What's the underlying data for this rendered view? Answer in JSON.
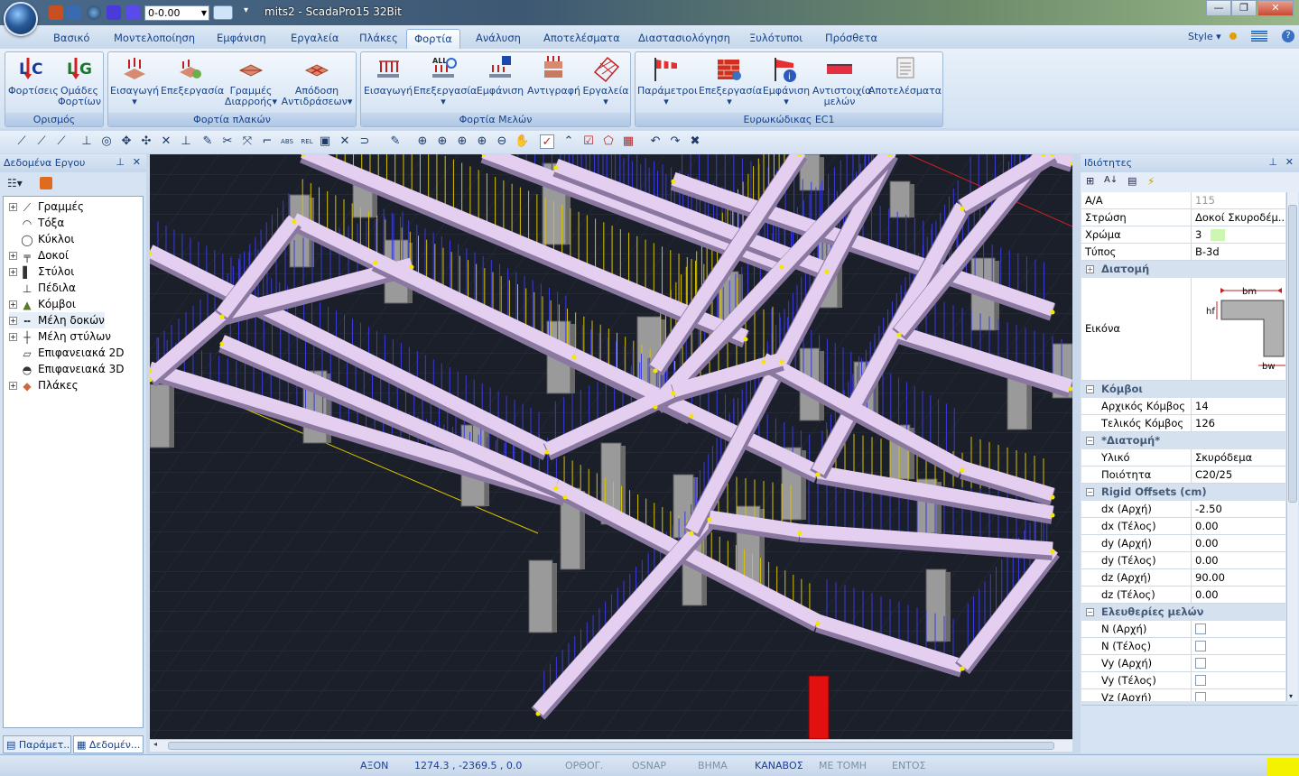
{
  "titlebar": {
    "title": "mits2 - ScadaPro15 32Bit",
    "level_value": "0-0.00",
    "buttons": {
      "minimize": "—",
      "restore": "❐",
      "close": "✕"
    }
  },
  "menu": {
    "tabs": [
      "Βασικό",
      "Μοντελοποίηση",
      "Εμφάνιση",
      "Εργαλεία",
      "Πλάκες",
      "Φορτία",
      "Ανάλυση",
      "Αποτελέσματα",
      "Διαστασιολόγηση",
      "Ξυλότυποι",
      "Πρόσθετα"
    ],
    "active_tab": "Φορτία",
    "style_label": "Style"
  },
  "ribbon": {
    "groups": [
      {
        "title": "Ορισμός",
        "buttons": [
          {
            "label": "Φορτίσεις",
            "icon": "lc-icon"
          },
          {
            "label": "Ομάδες Φορτίων",
            "icon": "lg-icon"
          }
        ]
      },
      {
        "title": "Φορτία πλακών",
        "buttons": [
          {
            "label": "Εισαγωγή",
            "icon": "slab-load-insert-icon"
          },
          {
            "label": "Επεξεργασία",
            "icon": "slab-load-edit-icon"
          },
          {
            "label": "Γραμμές Διαρροής",
            "icon": "yield-lines-icon"
          },
          {
            "label": "Απόδοση Αντιδράσεων",
            "icon": "reactions-icon"
          }
        ]
      },
      {
        "title": "Φορτία Μελών",
        "buttons": [
          {
            "label": "Εισαγωγή",
            "icon": "member-load-insert-icon"
          },
          {
            "label": "Επεξεργασία",
            "icon": "member-load-edit-icon"
          },
          {
            "label": "Εμφάνιση",
            "icon": "member-load-show-icon"
          },
          {
            "label": "Αντιγραφή",
            "icon": "copy-icon"
          },
          {
            "label": "Εργαλεία",
            "icon": "tools-grid-icon"
          }
        ]
      },
      {
        "title": "Ευρωκώδικας EC1",
        "buttons": [
          {
            "label": "Παράμετροι",
            "icon": "windsock-icon"
          },
          {
            "label": "Επεξεργασία",
            "icon": "wall-gear-icon"
          },
          {
            "label": "Εμφάνιση",
            "icon": "wind-info-icon"
          },
          {
            "label": "Αντιστοιχία μελών",
            "icon": "member-match-icon"
          },
          {
            "label": "Αποτελέσματα",
            "icon": "scroll-icon"
          }
        ]
      }
    ]
  },
  "left_panel": {
    "title": "Δεδομένα Εργου",
    "tree": [
      {
        "label": "Γραμμές",
        "icon": "line-icon",
        "expandable": true
      },
      {
        "label": "Τόξα",
        "icon": "arc-icon",
        "expandable": false
      },
      {
        "label": "Κύκλοι",
        "icon": "circle-icon",
        "expandable": false
      },
      {
        "label": "Δοκοί",
        "icon": "beam-icon",
        "expandable": true
      },
      {
        "label": "Στύλοι",
        "icon": "column-icon",
        "expandable": true
      },
      {
        "label": "Πέδιλα",
        "icon": "footing-icon",
        "expandable": false
      },
      {
        "label": "Κόμβοι",
        "icon": "node-icon",
        "expandable": true
      },
      {
        "label": "Μέλη δοκών",
        "icon": "beam-members-icon",
        "expandable": true
      },
      {
        "label": "Μέλη στύλων",
        "icon": "column-members-icon",
        "expandable": true
      },
      {
        "label": "Επιφανειακά 2D",
        "icon": "surface-2d-icon",
        "expandable": false
      },
      {
        "label": "Επιφανειακά 3D",
        "icon": "surface-3d-icon",
        "expandable": false
      },
      {
        "label": "Πλάκες",
        "icon": "slab-icon",
        "expandable": true
      }
    ],
    "bottom_tabs": [
      "Παράμετ...",
      "Δεδομέν..."
    ]
  },
  "properties": {
    "title": "Ιδιότητες",
    "rows_top": [
      {
        "key": "Α/Α",
        "value": "115",
        "muted": true
      },
      {
        "key": "Στρώση",
        "value": "Δοκοί Σκυροδέμ..."
      },
      {
        "key": "Χρώμα",
        "value": "3"
      },
      {
        "key": "Τύπος",
        "value": "B-3d"
      }
    ],
    "color_swatch": "#ccf7b0",
    "section_cat": "Διατομή",
    "image_row": {
      "key": "Εικόνα",
      "labels": {
        "bm": "bm",
        "hf": "hf",
        "bw": "bw"
      }
    },
    "nodes_cat": "Κόμβοι",
    "nodes": [
      {
        "key": "Αρχικός Κόμβος",
        "value": "14"
      },
      {
        "key": "Τελικός Κόμβος",
        "value": "126"
      }
    ],
    "section2_cat": "*Διατομή*",
    "material": [
      {
        "key": "Υλικό",
        "value": "Σκυρόδεμα"
      },
      {
        "key": "Ποιότητα",
        "value": "C20/25"
      }
    ],
    "offsets_cat": "Rigid Offsets (cm)",
    "offsets": [
      {
        "key": "dx (Αρχή)",
        "value": "-2.50"
      },
      {
        "key": "dx (Τέλος)",
        "value": "0.00"
      },
      {
        "key": "dy (Αρχή)",
        "value": "0.00"
      },
      {
        "key": "dy (Τέλος)",
        "value": "0.00"
      },
      {
        "key": "dz (Αρχή)",
        "value": "90.00"
      },
      {
        "key": "dz (Τέλος)",
        "value": "0.00"
      }
    ],
    "freedom_cat": "Ελευθερίες μελών",
    "freedoms": [
      "N (Αρχή)",
      "N (Τέλος)",
      "Vy (Αρχή)",
      "Vy (Τέλος)",
      "Vz (Αρχή)"
    ]
  },
  "statusbar": {
    "items": [
      {
        "label": "ΑΞΟΝ",
        "on": true
      },
      {
        "label": "1274.3 , -2369.5 , 0.0",
        "on": true
      },
      {
        "label": "ΟΡΘΟΓ.",
        "on": false
      },
      {
        "label": "OSNAP",
        "on": false
      },
      {
        "label": "ΒΗΜΑ",
        "on": false
      },
      {
        "label": "ΚΑΝΑΒΟΣ",
        "on": true
      },
      {
        "label": "ΜΕ ΤΟΜΗ",
        "on": false
      },
      {
        "label": "ΕΝΤΟΣ",
        "on": false
      }
    ]
  },
  "colors": {
    "viewport_bg": "#1a1f29",
    "beam": "#e4cff0",
    "column": "#9a9a9a",
    "load_lines": "#3a3adf",
    "load_yellow": "#d8c200",
    "selected_column": "#e31010"
  }
}
